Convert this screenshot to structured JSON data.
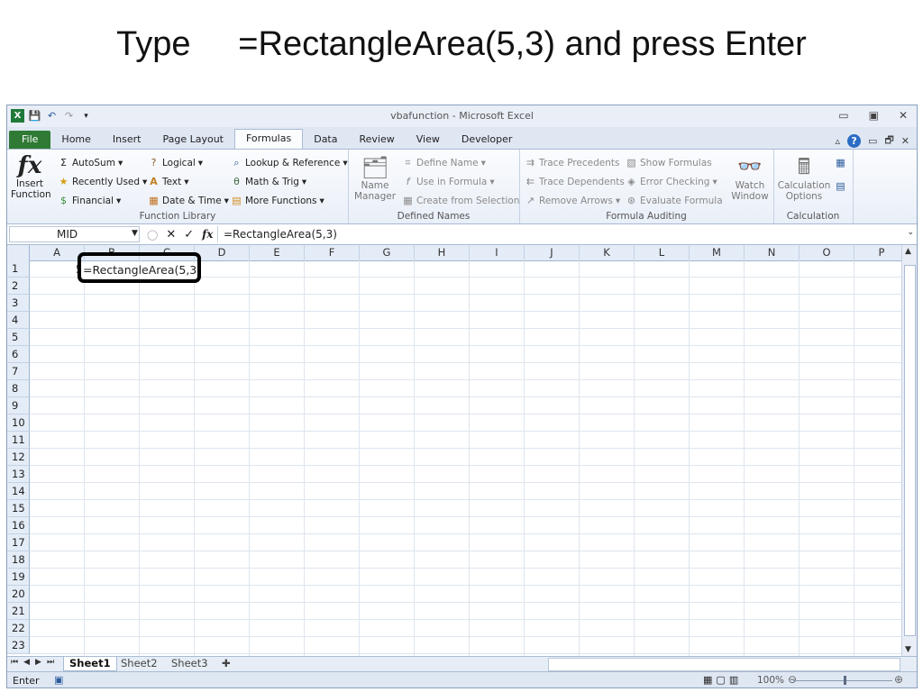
{
  "slide": {
    "title": "Type     =RectangleArea(5,3) and press Enter"
  },
  "window": {
    "title": "vbafunction  -  Microsoft Excel",
    "controls": [
      "▭",
      "▣",
      "✕"
    ],
    "doc_controls": [
      "▭",
      "🗗",
      "✕"
    ]
  },
  "tabs": [
    "File",
    "Home",
    "Insert",
    "Page Layout",
    "Formulas",
    "Data",
    "Review",
    "View",
    "Developer"
  ],
  "active_tab": "Formulas",
  "ribbon": {
    "function_library": {
      "insert_function": "Insert\nFunction",
      "autosum": "AutoSum",
      "recently_used": "Recently Used",
      "financial": "Financial",
      "logical": "Logical",
      "text": "Text",
      "date_time": "Date & Time",
      "lookup": "Lookup & Reference",
      "math": "Math & Trig",
      "more": "More Functions",
      "label": "Function Library"
    },
    "defined_names": {
      "name_manager": "Name\nManager",
      "define_name": "Define Name",
      "use_in_formula": "Use in Formula",
      "create_from_selection": "Create from Selection",
      "label": "Defined Names"
    },
    "formula_auditing": {
      "trace_precedents": "Trace Precedents",
      "trace_dependents": "Trace Dependents",
      "remove_arrows": "Remove Arrows",
      "show_formulas": "Show Formulas",
      "error_checking": "Error Checking",
      "evaluate_formula": "Evaluate Formula",
      "watch_window": "Watch\nWindow",
      "label": "Formula Auditing"
    },
    "calculation": {
      "calc_options": "Calculation\nOptions",
      "label": "Calculation"
    }
  },
  "formula_bar": {
    "name_box": "MID",
    "fx": "fx",
    "cancel": "✕",
    "enter": "✓",
    "content": "=RectangleArea(5,3)"
  },
  "columns": [
    "A",
    "B",
    "C",
    "D",
    "E",
    "F",
    "G",
    "H",
    "I",
    "J",
    "K",
    "L",
    "M",
    "N",
    "O",
    "P"
  ],
  "rows": [
    "1",
    "2",
    "3",
    "4",
    "5",
    "6",
    "7",
    "8",
    "9",
    "10",
    "11",
    "12",
    "13",
    "14",
    "15",
    "16",
    "17",
    "18",
    "19",
    "20",
    "21",
    "22",
    "23"
  ],
  "cells": {
    "A1_clipped": "5",
    "B1_edit": "=RectangleArea(5,3)"
  },
  "sheets": [
    "Sheet1",
    "Sheet2",
    "Sheet3"
  ],
  "active_sheet": "Sheet1",
  "status": {
    "mode": "Enter",
    "zoom": "100%"
  }
}
